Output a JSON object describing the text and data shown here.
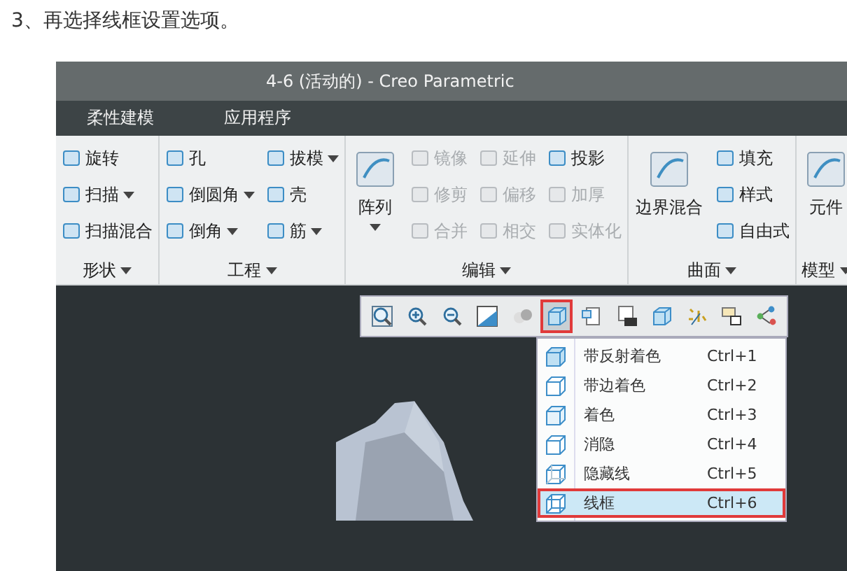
{
  "caption": "3、再选择线框设置选项。",
  "window": {
    "title": "4-6 (活动的) - Creo Parametric"
  },
  "menu_tabs": [
    {
      "label": "柔性建模"
    },
    {
      "label": "应用程序"
    }
  ],
  "ribbon": {
    "groups": [
      {
        "label": "形状",
        "columns": [
          [
            {
              "label": "旋转",
              "kind": "small",
              "dropdown": false,
              "disabled": false
            },
            {
              "label": "扫描",
              "kind": "small",
              "dropdown": true,
              "disabled": false
            },
            {
              "label": "扫描混合",
              "kind": "small",
              "dropdown": false,
              "disabled": false
            }
          ]
        ]
      },
      {
        "label": "工程",
        "columns": [
          [
            {
              "label": "孔",
              "kind": "small",
              "dropdown": false,
              "disabled": false
            },
            {
              "label": "倒圆角",
              "kind": "small",
              "dropdown": true,
              "disabled": false
            },
            {
              "label": "倒角",
              "kind": "small",
              "dropdown": true,
              "disabled": false
            }
          ],
          [
            {
              "label": "拔模",
              "kind": "small",
              "dropdown": true,
              "disabled": false
            },
            {
              "label": "壳",
              "kind": "small",
              "dropdown": false,
              "disabled": false
            },
            {
              "label": "筋",
              "kind": "small",
              "dropdown": true,
              "disabled": false
            }
          ]
        ]
      },
      {
        "label": "编辑",
        "columns": [
          [
            {
              "label": "阵列",
              "kind": "large",
              "dropdown": true,
              "disabled": false
            }
          ],
          [
            {
              "label": "镜像",
              "kind": "small",
              "dropdown": false,
              "disabled": true
            },
            {
              "label": "修剪",
              "kind": "small",
              "dropdown": false,
              "disabled": true
            },
            {
              "label": "合并",
              "kind": "small",
              "dropdown": false,
              "disabled": true
            }
          ],
          [
            {
              "label": "延伸",
              "kind": "small",
              "dropdown": false,
              "disabled": true
            },
            {
              "label": "偏移",
              "kind": "small",
              "dropdown": false,
              "disabled": true
            },
            {
              "label": "相交",
              "kind": "small",
              "dropdown": false,
              "disabled": true
            }
          ],
          [
            {
              "label": "投影",
              "kind": "small",
              "dropdown": false,
              "disabled": false
            },
            {
              "label": "加厚",
              "kind": "small",
              "dropdown": false,
              "disabled": true
            },
            {
              "label": "实体化",
              "kind": "small",
              "dropdown": false,
              "disabled": true
            }
          ]
        ]
      },
      {
        "label": "曲面",
        "columns": [
          [
            {
              "label": "边界混合",
              "kind": "large",
              "dropdown": false,
              "disabled": false
            }
          ],
          [
            {
              "label": "填充",
              "kind": "small",
              "dropdown": false,
              "disabled": false
            },
            {
              "label": "样式",
              "kind": "small",
              "dropdown": false,
              "disabled": false
            },
            {
              "label": "自由式",
              "kind": "small",
              "dropdown": false,
              "disabled": false
            }
          ]
        ]
      },
      {
        "label": "模型",
        "columns": [
          [
            {
              "label": "元件",
              "kind": "large",
              "dropdown": false,
              "disabled": false
            }
          ]
        ]
      }
    ]
  },
  "view_toolbar": [
    {
      "kind": "zoom-fit",
      "selected": false
    },
    {
      "kind": "zoom-in",
      "selected": false
    },
    {
      "kind": "zoom-out",
      "selected": false
    },
    {
      "kind": "repaint",
      "selected": false
    },
    {
      "kind": "spheres",
      "selected": false
    },
    {
      "kind": "cube",
      "selected": true
    },
    {
      "kind": "page",
      "selected": false
    },
    {
      "kind": "camera",
      "selected": false
    },
    {
      "kind": "cube",
      "selected": false
    },
    {
      "kind": "points",
      "selected": false
    },
    {
      "kind": "layers",
      "selected": false
    },
    {
      "kind": "nodes",
      "selected": false
    }
  ],
  "display_menu": [
    {
      "label": "带反射着色",
      "shortcut": "Ctrl+1",
      "selected": false
    },
    {
      "label": "带边着色",
      "shortcut": "Ctrl+2",
      "selected": false
    },
    {
      "label": "着色",
      "shortcut": "Ctrl+3",
      "selected": false
    },
    {
      "label": "消隐",
      "shortcut": "Ctrl+4",
      "selected": false
    },
    {
      "label": "隐藏线",
      "shortcut": "Ctrl+5",
      "selected": false
    },
    {
      "label": "线框",
      "shortcut": "Ctrl+6",
      "selected": true
    }
  ]
}
